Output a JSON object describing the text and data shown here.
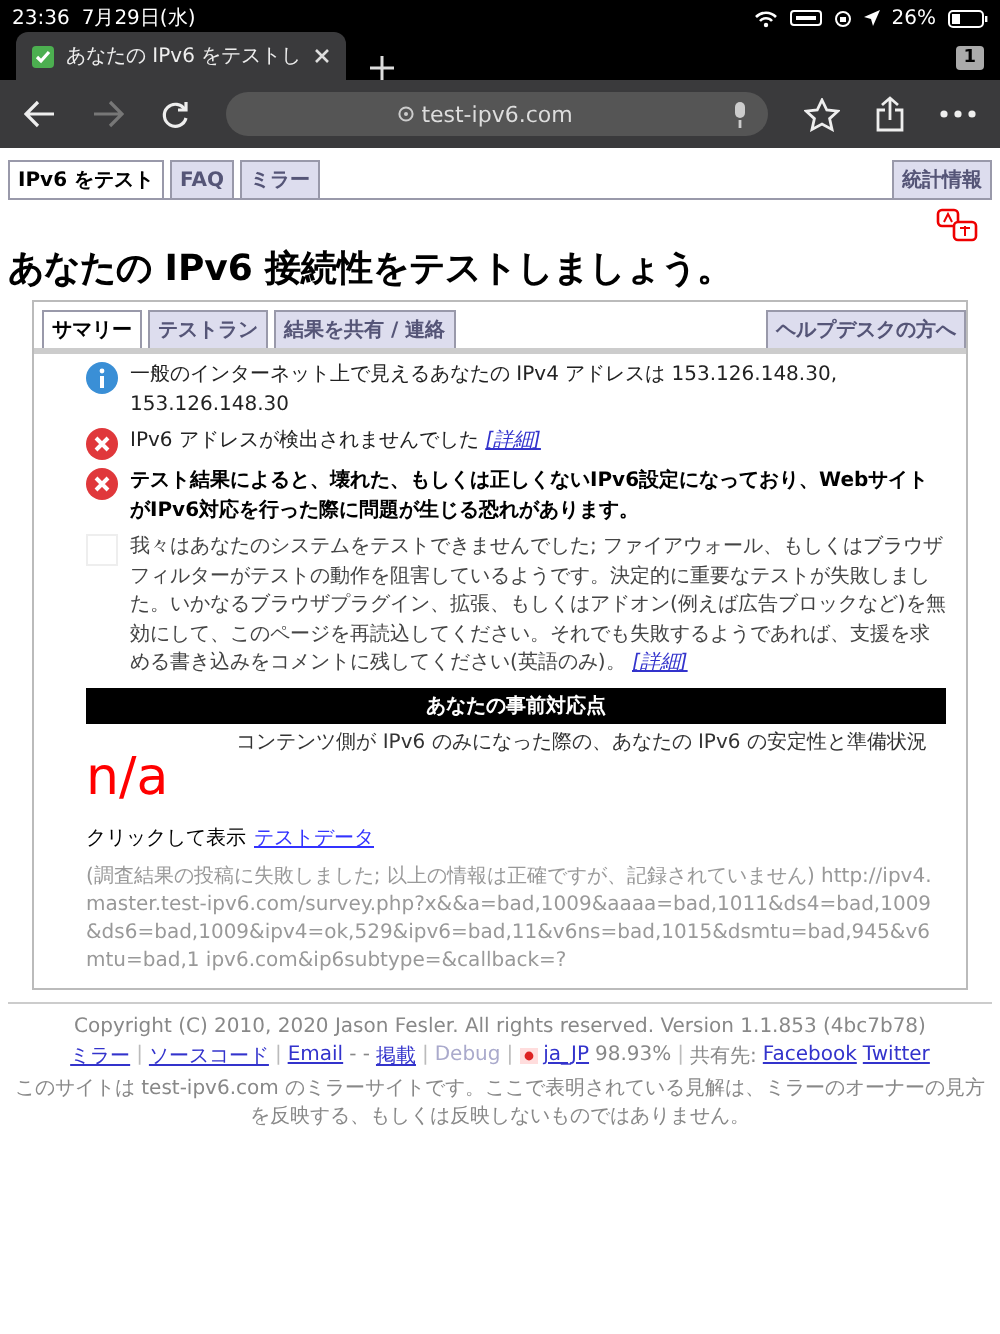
{
  "status_bar": {
    "time": "23:36",
    "date": "7月29日(水)",
    "battery": "26%"
  },
  "browser": {
    "tab_title": "あなたの IPv6 をテストし",
    "tab_count": "1",
    "url": "test-ipv6.com"
  },
  "site_tabs": [
    {
      "label": "IPv6 をテスト",
      "selected": true
    },
    {
      "label": "FAQ",
      "selected": false
    },
    {
      "label": "ミラー",
      "selected": false
    }
  ],
  "stats_tab": "統計情報",
  "heading": "あなたの IPv6 接続性をテストしましょう。",
  "inner_tabs": [
    {
      "label": "サマリー",
      "selected": true
    },
    {
      "label": "テストラン",
      "selected": false
    },
    {
      "label": "結果を共有 / 連絡",
      "selected": false
    }
  ],
  "helpdesk_tab": "ヘルプデスクの方へ",
  "results": [
    {
      "kind": "info",
      "text": "一般のインターネット上で見えるあなたの IPv4 アドレスは 153.126.148.30, 153.126.148.30",
      "bold": false
    },
    {
      "kind": "error",
      "text": "IPv6 アドレスが検出されませんでした",
      "link": "[詳細]",
      "bold": false
    },
    {
      "kind": "error",
      "text": "テスト結果によると、壊れた、もしくは正しくないIPv6設定になっており、WebサイトがIPv6対応を行った際に問題が生じる恐れがあります。",
      "bold": true
    },
    {
      "kind": "blank",
      "text": "我々はあなたのシステムをテストできませんでした; ファイアウォール、もしくはブラウザフィルターがテストの動作を阻害しているようです。決定的に重要なテストが失敗しました。いかなるブラウザプラグイン、拡張、もしくはアドオン(例えば広告ブロックなど)を無効にして、このページを再読込してください。それでも失敗するようであれば、支援を求める書き込みをコメントに残してください(英語のみ)。",
      "link": "[詳細]",
      "bold": false
    }
  ],
  "readiness": {
    "title": "あなたの事前対応点",
    "score": "n/a",
    "caption": "コンテンツ側が IPv6 のみになった際の、あなたの IPv6 の安定性と準備状況"
  },
  "test_data": {
    "label": "クリックして表示",
    "link": "テストデータ"
  },
  "survey": "(調査結果の投稿に失敗しました; 以上の情報は正確ですが、記録されていません) http://ipv4.master.test-ipv6.com/survey.php?x&&a=bad,1009&aaaa=bad,1011&ds4=bad,1009&ds6=bad,1009&ipv4=ok,529&ipv6=bad,11&v6ns=bad,1015&dsmtu=bad,945&v6mtu=bad,1 ipv6.com&ip6subtype=&callback=?",
  "footer": {
    "copyright": "Copyright (C) 2010, 2020 Jason Fesler. All rights reserved. Version 1.1.853 (4bc7b78)",
    "items": [
      {
        "kind": "link",
        "text": "ミラー"
      },
      {
        "kind": "sep",
        "text": "|"
      },
      {
        "kind": "link",
        "text": "ソースコード"
      },
      {
        "kind": "sep",
        "text": "|"
      },
      {
        "kind": "link",
        "text": "Email"
      },
      {
        "kind": "plain",
        "text": "-  -"
      },
      {
        "kind": "link",
        "text": "掲載"
      },
      {
        "kind": "sep",
        "text": "|"
      },
      {
        "kind": "faded",
        "text": "Debug"
      },
      {
        "kind": "sep",
        "text": "|"
      },
      {
        "kind": "flag",
        "text": "ja_JP"
      },
      {
        "kind": "plain",
        "text": "98.93%"
      },
      {
        "kind": "sep",
        "text": "|"
      },
      {
        "kind": "plain",
        "text": "共有先:"
      },
      {
        "kind": "link",
        "text": "Facebook"
      },
      {
        "kind": "link",
        "text": "Twitter"
      }
    ],
    "notice": "このサイトは test-ipv6.com のミラーサイトです。ここで表明されている見解は、ミラーのオーナーの見方を反映する、もしくは反映しないものではありません。"
  }
}
